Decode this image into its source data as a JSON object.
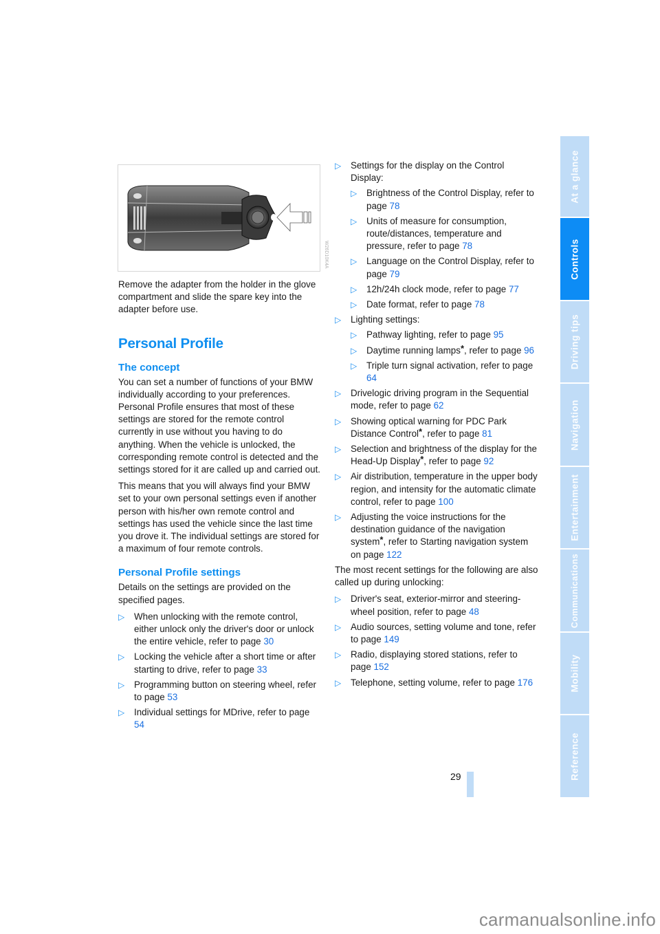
{
  "side_tabs": [
    {
      "label": "At a glance",
      "active": false
    },
    {
      "label": "Controls",
      "active": true
    },
    {
      "label": "Driving tips",
      "active": false
    },
    {
      "label": "Navigation",
      "active": false
    },
    {
      "label": "Entertainment",
      "active": false
    },
    {
      "label": "Communications",
      "active": false
    },
    {
      "label": "Mobility",
      "active": false
    },
    {
      "label": "Reference",
      "active": false
    }
  ],
  "figure": {
    "alt": "Remote control key with spare key adapter and arrow",
    "code": "W26D10K4A"
  },
  "intro_text": "Remove the adapter from the holder in the glove compartment and slide the spare key into the adapter before use.",
  "section_title": "Personal Profile",
  "concept": {
    "heading": "The concept",
    "para1": "You can set a number of functions of your BMW individually according to your preferences. Personal Profile ensures that most of these settings are stored for the remote control currently in use without you having to do anything. When the vehicle is unlocked, the corresponding remote control is detected and the settings stored for it are called up and carried out.",
    "para2": "This means that you will always find your BMW set to your own personal settings even if another person with his/her own remote control and settings has used the vehicle since the last time you drove it. The individual settings are stored for a maximum of four remote controls."
  },
  "settings": {
    "heading": "Personal Profile settings",
    "intro": "Details on the settings are provided on the specified pages.",
    "left_items": [
      {
        "text": "When unlocking with the remote control, either unlock only the driver's door or unlock the entire vehicle, refer to page ",
        "page": "30"
      },
      {
        "text": "Locking the vehicle after a short time or after starting to drive, refer to page ",
        "page": "33"
      },
      {
        "text": "Programming button on steering wheel, refer to page ",
        "page": "53"
      },
      {
        "text": "Individual settings for MDrive, refer to page ",
        "page": "54"
      }
    ],
    "display_group": {
      "text": "Settings for the display on the Control Display:",
      "items": [
        {
          "text": "Brightness of the Control Display, refer to page ",
          "page": "78"
        },
        {
          "text": "Units of measure for consumption, route/distances, temperature and pressure, refer to page ",
          "page": "78"
        },
        {
          "text": "Language on the Control Display, refer to page ",
          "page": "79"
        },
        {
          "text": "12h/24h clock mode, refer to page ",
          "page": "77"
        },
        {
          "text": "Date format, refer to page ",
          "page": "78"
        }
      ]
    },
    "lighting_group": {
      "text": "Lighting settings:",
      "items": [
        {
          "text": "Pathway lighting, refer to page ",
          "page": "95"
        },
        {
          "text": "Daytime running lamps",
          "star": "*",
          "text2": ", refer to page ",
          "page": "96"
        },
        {
          "text": "Triple turn signal activation, refer to page ",
          "page": "64"
        }
      ]
    },
    "right_items": [
      {
        "text": "Drivelogic driving program in the Sequential mode, refer to page ",
        "page": "62"
      },
      {
        "text": "Showing optical warning for PDC Park Distance Control",
        "star": "*",
        "text2": ", refer to page ",
        "page": "81"
      },
      {
        "text": "Selection and brightness of the display for the Head-Up Display",
        "star": "*",
        "text2": ", refer to page ",
        "page": "92"
      },
      {
        "text": "Air distribution, temperature in the upper body region, and intensity for the automatic climate control, refer to page ",
        "page": "100"
      },
      {
        "text": "Adjusting the voice instructions for the destination guidance of the navigation system",
        "star": "*",
        "text2": ", refer to Starting navigation system on page ",
        "page": "122"
      }
    ]
  },
  "recent": {
    "intro": "The most recent settings for the following are also called up during unlocking:",
    "items": [
      {
        "text": "Driver's seat, exterior-mirror and steering-wheel position, refer to page ",
        "page": "48"
      },
      {
        "text": "Audio sources, setting volume and tone, refer to page ",
        "page": "149"
      },
      {
        "text": "Radio, displaying stored stations, refer to page ",
        "page": "152"
      },
      {
        "text": "Telephone, setting volume, refer to page ",
        "page": "176"
      }
    ]
  },
  "bullet_glyph": "▷",
  "page_number": "29",
  "watermark": "carmanualsonline.info",
  "colors": {
    "accent": "#0e8ef0",
    "link": "#1a6fe0",
    "tab_active": "#0d8cf5",
    "tab_inactive": "#c0dcf7"
  }
}
